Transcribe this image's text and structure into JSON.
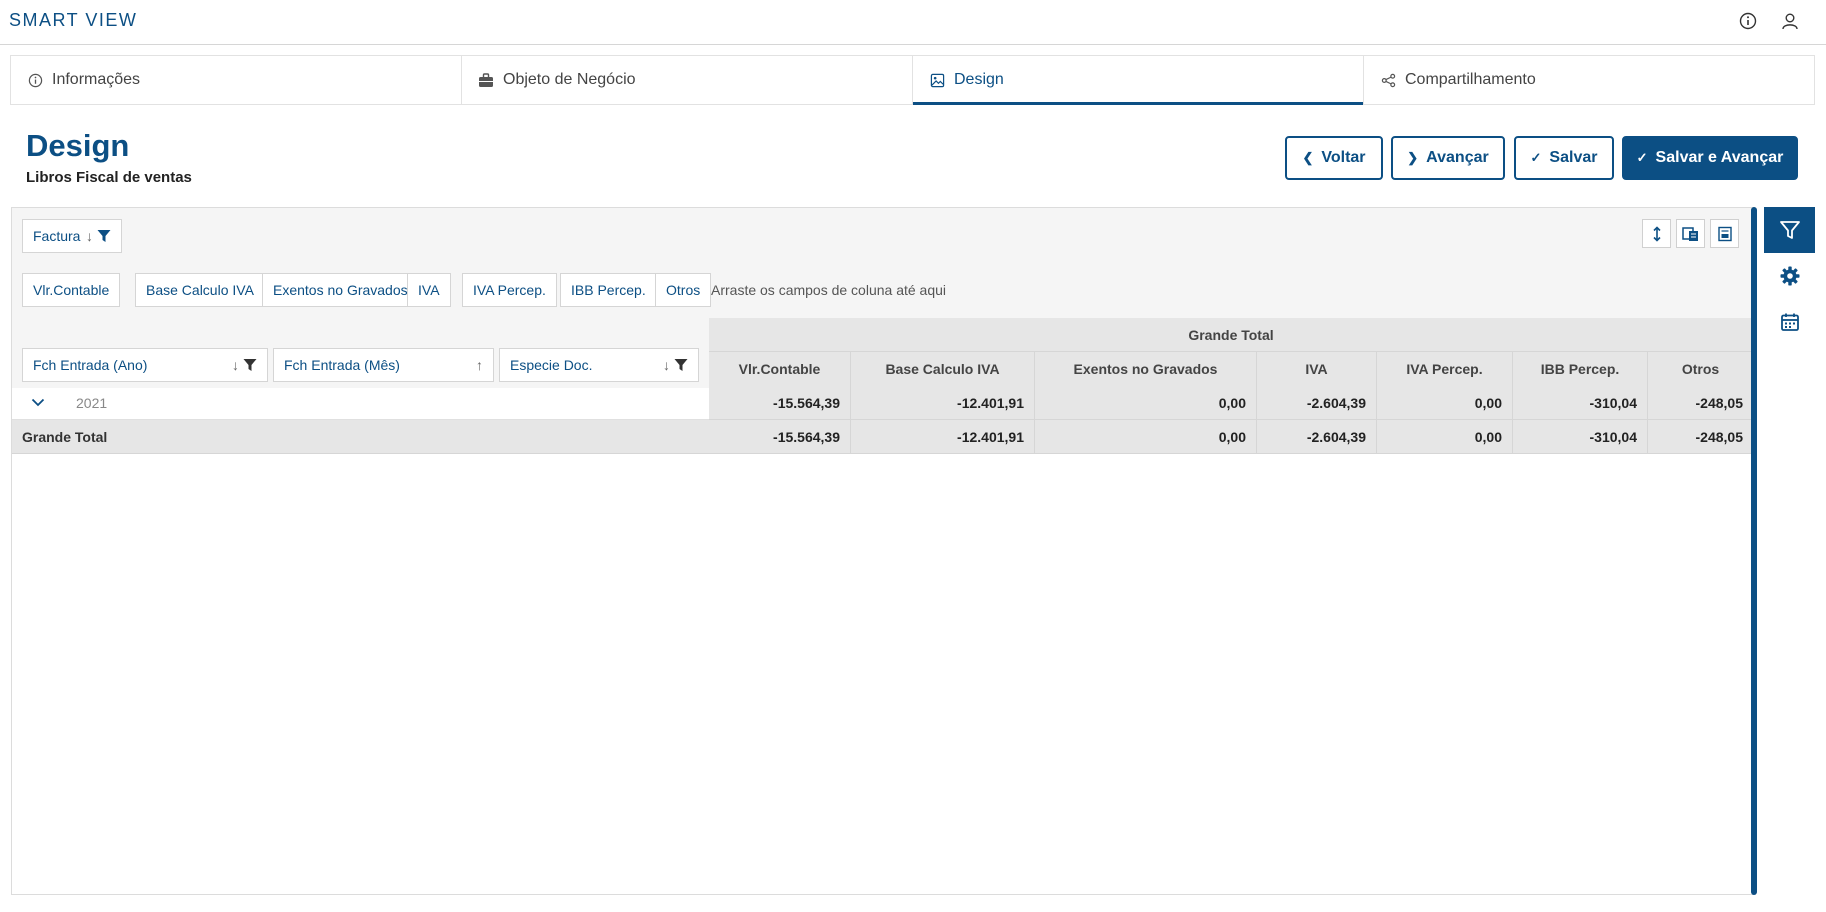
{
  "app": {
    "title": "SMART VIEW"
  },
  "top_icons": {
    "info": "info-icon",
    "user": "user-icon"
  },
  "tabs": [
    {
      "label": "Informações",
      "icon": "info-circle-icon"
    },
    {
      "label": "Objeto de Negócio",
      "icon": "briefcase-icon"
    },
    {
      "label": "Design",
      "icon": "image-icon",
      "active": true
    },
    {
      "label": "Compartilhamento",
      "icon": "share-icon"
    }
  ],
  "header": {
    "title": "Design",
    "subtitle": "Libros Fiscal de ventas"
  },
  "actions": {
    "back": "Voltar",
    "next": "Avançar",
    "save": "Salvar",
    "save_next": "Salvar e Avançar"
  },
  "pivot": {
    "filter_field": "Factura",
    "value_fields": [
      "Vlr.Contable",
      "Base Calculo IVA",
      "Exentos no Gravados",
      "IVA",
      "IVA Percep.",
      "IBB Percep.",
      "Otros"
    ],
    "column_hint": "Arraste os campos de coluna até aqui",
    "row_fields": [
      "Fch Entrada (Ano)",
      "Fch Entrada (Mês)",
      "Especie Doc."
    ],
    "grand_total_header": "Grande Total",
    "columns": [
      "Vlr.Contable",
      "Base Calculo IVA",
      "Exentos no Gravados",
      "IVA",
      "IVA Percep.",
      "IBB Percep.",
      "Otros"
    ],
    "rows": [
      {
        "label": "2021",
        "values": [
          "-15.564,39",
          "-12.401,91",
          "0,00",
          "-2.604,39",
          "0,00",
          "-310,04",
          "-248,05"
        ]
      }
    ],
    "total_row": {
      "label": "Grande Total",
      "values": [
        "-15.564,39",
        "-12.401,91",
        "0,00",
        "-2.604,39",
        "0,00",
        "-310,04",
        "-248,05"
      ]
    }
  },
  "colors": {
    "primary": "#0c4f84",
    "header_bg": "#e6e6e6",
    "panel_bg": "#f5f5f5"
  }
}
